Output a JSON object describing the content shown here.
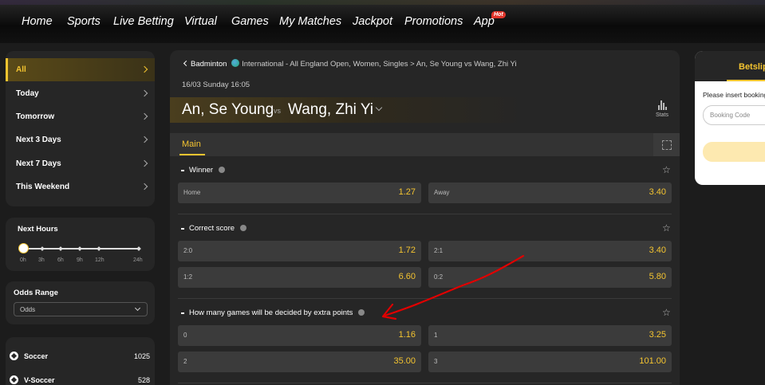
{
  "nav": {
    "items": [
      "Home",
      "Sports",
      "Live Betting",
      "Virtual",
      "Games",
      "My Matches",
      "Jackpot",
      "Promotions",
      "App"
    ],
    "hot_badge": "Hot"
  },
  "dates": {
    "items": [
      "All",
      "Today",
      "Tomorrow",
      "Next 3 Days",
      "Next 7 Days",
      "This Weekend"
    ],
    "active": "All"
  },
  "next_hours": {
    "label": "Next Hours",
    "ticks": [
      "0h",
      "3h",
      "6h",
      "9h",
      "12h",
      "24h"
    ]
  },
  "odds_range": {
    "label": "Odds Range",
    "select_value": "Odds"
  },
  "sports": [
    {
      "name": "Soccer",
      "count": "1025"
    },
    {
      "name": "V-Soccer",
      "count": "528"
    }
  ],
  "match": {
    "breadcrumb_sport": "Badminton",
    "breadcrumb_rest": "International - All England Open, Women, Singles > An, Se Young vs Wang, Zhi Yi",
    "date": "16/03 Sunday 16:05",
    "home": "An, Se Young",
    "vs": "vs",
    "away": "Wang, Zhi Yi",
    "stats_label": "Stats"
  },
  "tabs": {
    "main": "Main"
  },
  "markets": {
    "winner": {
      "title": "Winner",
      "odds": [
        {
          "name": "Home",
          "value": "1.27"
        },
        {
          "name": "Away",
          "value": "3.40"
        }
      ]
    },
    "correct_score": {
      "title": "Correct score",
      "odds": [
        {
          "name": "2:0",
          "value": "1.72"
        },
        {
          "name": "2:1",
          "value": "3.40"
        },
        {
          "name": "1:2",
          "value": "6.60"
        },
        {
          "name": "0:2",
          "value": "5.80"
        }
      ]
    },
    "extra_points": {
      "title": "How many games will be decided by extra points",
      "odds": [
        {
          "name": "0",
          "value": "1.16"
        },
        {
          "name": "1",
          "value": "3.25"
        },
        {
          "name": "2",
          "value": "35.00"
        },
        {
          "name": "3",
          "value": "101.00"
        }
      ]
    }
  },
  "betslip": {
    "title": "Betslip",
    "message": "Please insert booking code",
    "booking_placeholder": "Booking Code"
  },
  "colors": {
    "accent": "#f4c430",
    "annotation": "#e00000"
  }
}
